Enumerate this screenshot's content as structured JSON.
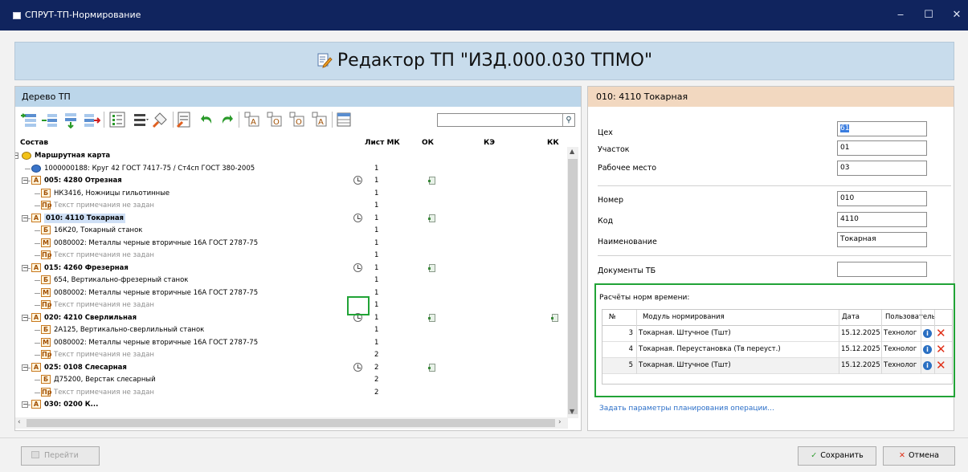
{
  "window": {
    "title": "СПРУТ-ТП-Нормирование",
    "controls": {
      "minimize": "‒",
      "maximize": "☐",
      "close": "✕"
    }
  },
  "header": {
    "title": "Редактор ТП \"ИЗД.000.030 ТПМО\""
  },
  "tree_panel": {
    "title": "Дерево ТП",
    "search": {
      "value": "",
      "placeholder": ""
    },
    "columns": [
      "Состав",
      "Лист МК",
      "ОК",
      "КЭ",
      "КК"
    ],
    "rows": [
      {
        "indent": 0,
        "icon": "route-card-icon",
        "text": "Маршрутная карта",
        "bold": true
      },
      {
        "indent": 1,
        "icon": "blank-part-icon",
        "text": "1000000188: Круг 42 ГОСТ 7417-75 / Ст4сп ГОСТ 380-2005",
        "sheet": "1"
      },
      {
        "indent": 1,
        "badge": "А",
        "text": "005: 4280 Отрезная",
        "bold": true,
        "clock": true,
        "sheet": "1",
        "ok": true
      },
      {
        "indent": 2,
        "badge": "Б",
        "text": "НК3416, Ножницы гильотинные",
        "sheet": "1"
      },
      {
        "indent": 2,
        "badge": "Пр",
        "text": "Текст примечания не задан",
        "gray": true,
        "sheet": "1"
      },
      {
        "indent": 1,
        "badge": "А",
        "text": "010: 4110 Токарная",
        "bold": true,
        "selected": true,
        "clock": true,
        "sheet": "1",
        "ok": true
      },
      {
        "indent": 2,
        "badge": "Б",
        "text": "16К20, Токарный станок",
        "sheet": "1"
      },
      {
        "indent": 2,
        "badge": "М",
        "text": "0080002: Металлы черные вторичные 16А ГОСТ 2787-75",
        "sheet": "1"
      },
      {
        "indent": 2,
        "badge": "Пр",
        "text": "Текст примечания не задан",
        "gray": true,
        "sheet": "1"
      },
      {
        "indent": 1,
        "badge": "А",
        "text": "015: 4260 Фрезерная",
        "bold": true,
        "clock": true,
        "sheet": "1",
        "ok": true
      },
      {
        "indent": 2,
        "badge": "Б",
        "text": "654, Вертикально-фрезерный станок",
        "sheet": "1"
      },
      {
        "indent": 2,
        "badge": "М",
        "text": "0080002: Металлы черные вторичные 16А ГОСТ 2787-75",
        "sheet": "1"
      },
      {
        "indent": 2,
        "badge": "Пр",
        "text": "Текст примечания не задан",
        "gray": true,
        "sheet": "1"
      },
      {
        "indent": 1,
        "badge": "А",
        "text": "020: 4210 Сверлильная",
        "bold": true,
        "clock": true,
        "sheet": "1",
        "ok": true,
        "kk": true
      },
      {
        "indent": 2,
        "badge": "Б",
        "text": "2А125, Вертикально-сверлильный станок",
        "sheet": "1"
      },
      {
        "indent": 2,
        "badge": "М",
        "text": "0080002: Металлы черные вторичные 16А ГОСТ 2787-75",
        "sheet": "1"
      },
      {
        "indent": 2,
        "badge": "Пр",
        "text": "Текст примечания не задан",
        "gray": true,
        "sheet": "2"
      },
      {
        "indent": 1,
        "badge": "А",
        "text": "025: 0108 Слесарная",
        "bold": true,
        "clock": true,
        "sheet": "2",
        "ok": true
      },
      {
        "indent": 2,
        "badge": "Б",
        "text": "Д75200, Верстак слесарный",
        "sheet": "2"
      },
      {
        "indent": 2,
        "badge": "Пр",
        "text": "Текст примечания не задан",
        "gray": true,
        "sheet": "2"
      },
      {
        "indent": 1,
        "badge": "А",
        "text": "030: 0200 К...",
        "bold": true,
        "sheet": ""
      }
    ]
  },
  "details": {
    "title": "010: 4110 Токарная",
    "fields": {
      "workshop": {
        "label": "Цех",
        "value": "61"
      },
      "section": {
        "label": "Участок",
        "value": "01"
      },
      "workplace": {
        "label": "Рабочее место",
        "value": "03"
      },
      "number": {
        "label": "Номер",
        "value": "010"
      },
      "code": {
        "label": "Код",
        "value": "4110"
      },
      "name": {
        "label": "Наименование",
        "value": "Токарная"
      },
      "safety_docs": {
        "label": "Документы ТБ",
        "value": ""
      }
    },
    "norms": {
      "title": "Расчёты норм времени:",
      "headers": [
        "№",
        "Модуль нормирования",
        "Дата",
        "Пользователь"
      ],
      "rows": [
        {
          "n": "3",
          "module": "Токарная. Штучное (Тшт)",
          "date": "15.12.2025",
          "user": "Технолог"
        },
        {
          "n": "4",
          "module": "Токарная. Переустановка (Тв переуст.)",
          "date": "15.12.2025",
          "user": "Технолог"
        },
        {
          "n": "5",
          "module": "Токарная. Штучное (Тшт)",
          "date": "15.12.2025",
          "user": "Технолог"
        }
      ]
    },
    "planning_link": "Задать параметры планирования операции..."
  },
  "footer": {
    "goto": "Перейти",
    "save": "Сохранить",
    "cancel": "Отмена"
  },
  "colors": {
    "titlebar": "#10245e",
    "tree_header": "#bcd6ea",
    "detail_header": "#f2d8c0",
    "highlight": "#21a336",
    "delete": "#e03018",
    "info": "#2a6fc2"
  }
}
